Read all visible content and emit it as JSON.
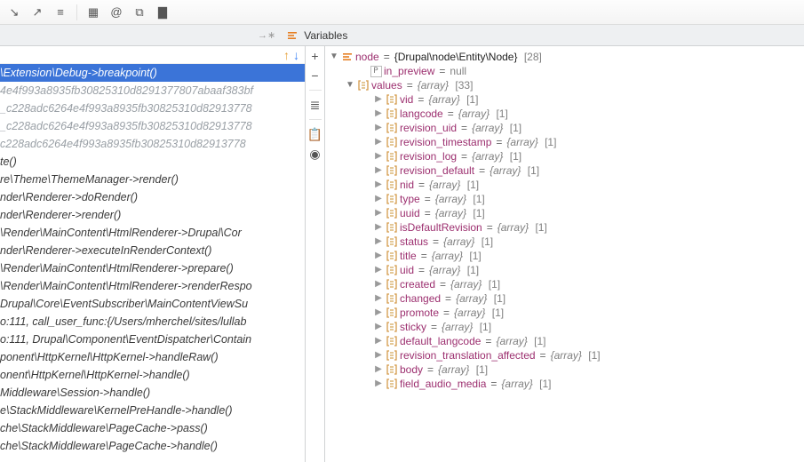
{
  "toolbar": {
    "buttons": [
      "step-out",
      "step-into",
      "eval",
      "sep",
      "grid",
      "at",
      "tree",
      "breakpoints"
    ]
  },
  "tabs": {
    "variables": "Variables"
  },
  "left_pane": {
    "nav": {
      "up": "↑",
      "down": "↓"
    }
  },
  "stack": [
    {
      "kind": "sel",
      "text": "\\Extension\\Debug->breakpoint()"
    },
    {
      "kind": "hash",
      "text": "4e4f993a8935fb30825310d8291377807abaaf383bf"
    },
    {
      "kind": "hash",
      "text": "_c228adc6264e4f993a8935fb30825310d82913778"
    },
    {
      "kind": "hash",
      "text": "_c228adc6264e4f993a8935fb30825310d82913778"
    },
    {
      "kind": "hash",
      "text": "c228adc6264e4f993a8935fb30825310d82913778"
    },
    {
      "kind": "n",
      "text": "te()"
    },
    {
      "kind": "n",
      "text": "re\\Theme\\ThemeManager->render()"
    },
    {
      "kind": "n",
      "text": "nder\\Renderer->doRender()"
    },
    {
      "kind": "n",
      "text": "nder\\Renderer->render()"
    },
    {
      "kind": "n",
      "text": "\\Render\\MainContent\\HtmlRenderer->Drupal\\Cor"
    },
    {
      "kind": "n",
      "text": "nder\\Renderer->executeInRenderContext()"
    },
    {
      "kind": "n",
      "text": "\\Render\\MainContent\\HtmlRenderer->prepare()"
    },
    {
      "kind": "n",
      "text": "\\Render\\MainContent\\HtmlRenderer->renderRespo"
    },
    {
      "kind": "n",
      "text": " Drupal\\Core\\EventSubscriber\\MainContentViewSu"
    },
    {
      "kind": "n",
      "text": "o:111, call_user_func:{/Users/mherchel/sites/lullab"
    },
    {
      "kind": "n",
      "text": "o:111, Drupal\\Component\\EventDispatcher\\Contain"
    },
    {
      "kind": "n",
      "text": "ponent\\HttpKernel\\HttpKernel->handleRaw()"
    },
    {
      "kind": "n",
      "text": "onent\\HttpKernel\\HttpKernel->handle()"
    },
    {
      "kind": "n",
      "text": "Middleware\\Session->handle()"
    },
    {
      "kind": "n",
      "text": "e\\StackMiddleware\\KernelPreHandle->handle()"
    },
    {
      "kind": "n",
      "text": "che\\StackMiddleware\\PageCache->pass()"
    },
    {
      "kind": "n",
      "text": "che\\StackMiddleware\\PageCache->handle()"
    }
  ],
  "gutter": {
    "buttons": [
      "plus",
      "minus",
      "sep",
      "filter",
      "sep",
      "clipboard",
      "watch"
    ]
  },
  "tree": {
    "root": {
      "name": "node",
      "value": "{Drupal\\node\\Entity\\Node}",
      "len": "[28]"
    },
    "in_preview": {
      "name": "in_preview",
      "value": "null"
    },
    "values": {
      "name": "values",
      "value": "{array}",
      "len": "[33]"
    },
    "children": [
      {
        "name": "vid",
        "value": "{array}",
        "len": "[1]"
      },
      {
        "name": "langcode",
        "value": "{array}",
        "len": "[1]"
      },
      {
        "name": "revision_uid",
        "value": "{array}",
        "len": "[1]"
      },
      {
        "name": "revision_timestamp",
        "value": "{array}",
        "len": "[1]"
      },
      {
        "name": "revision_log",
        "value": "{array}",
        "len": "[1]"
      },
      {
        "name": "revision_default",
        "value": "{array}",
        "len": "[1]"
      },
      {
        "name": "nid",
        "value": "{array}",
        "len": "[1]"
      },
      {
        "name": "type",
        "value": "{array}",
        "len": "[1]"
      },
      {
        "name": "uuid",
        "value": "{array}",
        "len": "[1]"
      },
      {
        "name": "isDefaultRevision",
        "value": "{array}",
        "len": "[1]"
      },
      {
        "name": "status",
        "value": "{array}",
        "len": "[1]"
      },
      {
        "name": "title",
        "value": "{array}",
        "len": "[1]"
      },
      {
        "name": "uid",
        "value": "{array}",
        "len": "[1]"
      },
      {
        "name": "created",
        "value": "{array}",
        "len": "[1]"
      },
      {
        "name": "changed",
        "value": "{array}",
        "len": "[1]"
      },
      {
        "name": "promote",
        "value": "{array}",
        "len": "[1]"
      },
      {
        "name": "sticky",
        "value": "{array}",
        "len": "[1]"
      },
      {
        "name": "default_langcode",
        "value": "{array}",
        "len": "[1]"
      },
      {
        "name": "revision_translation_affected",
        "value": "{array}",
        "len": "[1]"
      },
      {
        "name": "body",
        "value": "{array}",
        "len": "[1]"
      },
      {
        "name": "field_audio_media",
        "value": "{array}",
        "len": "[1]"
      }
    ]
  }
}
